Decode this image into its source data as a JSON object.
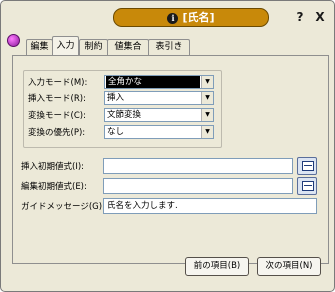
{
  "title": {
    "icon": "info-icon",
    "text": "[氏名]"
  },
  "controls": {
    "help": "?",
    "close": "X"
  },
  "tabs": [
    {
      "label": "編集"
    },
    {
      "label": "入力"
    },
    {
      "label": "制約"
    },
    {
      "label": "値集合"
    },
    {
      "label": "表引き"
    }
  ],
  "active_tab": "入力",
  "group": {
    "rows": [
      {
        "label": "入力モード(M):",
        "value": "全角かな"
      },
      {
        "label": "挿入モード(R):",
        "value": "挿入"
      },
      {
        "label": "変換モード(C):",
        "value": "文節変換"
      },
      {
        "label": "変換の優先(P):",
        "value": "なし"
      }
    ]
  },
  "fields": {
    "insert_initial": {
      "label": "挿入初期値式(I):",
      "value": ""
    },
    "edit_initial": {
      "label": "編集初期値式(E):",
      "value": ""
    },
    "guide_message": {
      "label": "ガイドメッセージ(G):",
      "value": "氏名を入力します."
    }
  },
  "buttons": {
    "prev": "前の項目(B)",
    "next": "次の項目(N)"
  }
}
